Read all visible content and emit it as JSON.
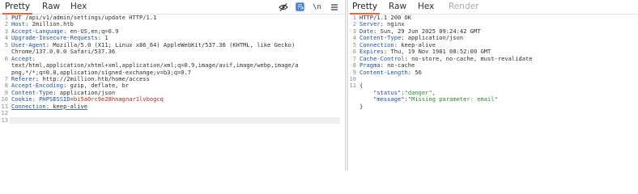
{
  "request": {
    "tabs": [
      "Pretty",
      "Raw",
      "Hex"
    ],
    "toolbar_wrap_icon_text": "\\n",
    "lines": [
      {
        "n": "1",
        "parts": [
          {
            "t": "PUT /api/v1/admin/settings/update HTTP/1.1",
            "c": "plain"
          }
        ]
      },
      {
        "n": "2",
        "parts": [
          {
            "t": "Host",
            "c": "hdr"
          },
          {
            "t": ": 2million.htb",
            "c": "plain"
          }
        ]
      },
      {
        "n": "3",
        "parts": [
          {
            "t": "Accept-Language",
            "c": "hdr"
          },
          {
            "t": ": en-US,en;q=0.9",
            "c": "plain"
          }
        ]
      },
      {
        "n": "4",
        "parts": [
          {
            "t": "Upgrade-Insecure-Requests",
            "c": "hdr"
          },
          {
            "t": ": 1",
            "c": "plain"
          }
        ]
      },
      {
        "n": "5",
        "parts": [
          {
            "t": "User-Agent",
            "c": "hdr"
          },
          {
            "t": ": Mozilla/5.0 (X11; Linux x86_64) AppleWebKit/537.36 (KHTML, like Gecko)",
            "c": "plain"
          }
        ]
      },
      {
        "n": "",
        "parts": [
          {
            "t": "Chrome/137.0.0.0 Safari/537.36",
            "c": "plain"
          }
        ]
      },
      {
        "n": "6",
        "parts": [
          {
            "t": "Accept",
            "c": "hdr"
          },
          {
            "t": ":",
            "c": "plain"
          }
        ]
      },
      {
        "n": "",
        "parts": [
          {
            "t": "text/html,application/xhtml+xml,application/xml;q=0.9,image/avif,image/webp,image/a",
            "c": "plain"
          }
        ]
      },
      {
        "n": "",
        "parts": [
          {
            "t": "png,*/*;q=0.8,application/signed-exchange;v=b3;q=0.7",
            "c": "plain"
          }
        ]
      },
      {
        "n": "7",
        "parts": [
          {
            "t": "Referer",
            "c": "hdr"
          },
          {
            "t": ": http://2million.htb/home/access",
            "c": "plain"
          }
        ]
      },
      {
        "n": "8",
        "parts": [
          {
            "t": "Accept-Encoding",
            "c": "hdr"
          },
          {
            "t": ": gzip, deflate, br",
            "c": "plain"
          }
        ]
      },
      {
        "n": "9",
        "parts": [
          {
            "t": "Content-Type",
            "c": "hdr"
          },
          {
            "t": ": application/json",
            "c": "plain"
          }
        ]
      },
      {
        "n": "10",
        "parts": [
          {
            "t": "Cookie",
            "c": "hdr"
          },
          {
            "t": ": PHPSESSID",
            "c": "hdr"
          },
          {
            "t": "=",
            "c": "plain"
          },
          {
            "t": "bi5a0rc9e28hnagnar1lvbogcq",
            "c": "cookie-val"
          }
        ]
      },
      {
        "n": "11",
        "parts": [
          {
            "t": "Connection",
            "c": "hdr"
          },
          {
            "t": ": keep-alive",
            "c": "plain"
          }
        ],
        "underline": true
      },
      {
        "n": "12",
        "parts": []
      },
      {
        "n": "13",
        "parts": [],
        "current": true
      }
    ]
  },
  "response": {
    "tabs": [
      "Pretty",
      "Raw",
      "Hex",
      "Render"
    ],
    "lines": [
      {
        "n": "1",
        "parts": [
          {
            "t": "HTTP/1.1 200 OK",
            "c": "plain"
          }
        ]
      },
      {
        "n": "2",
        "parts": [
          {
            "t": "Server",
            "c": "hdr"
          },
          {
            "t": ": nginx",
            "c": "plain"
          }
        ]
      },
      {
        "n": "3",
        "parts": [
          {
            "t": "Date",
            "c": "hdr"
          },
          {
            "t": ": Sun, 29 Jun 2025 09:24:42 GMT",
            "c": "plain"
          }
        ]
      },
      {
        "n": "4",
        "parts": [
          {
            "t": "Content-Type",
            "c": "hdr"
          },
          {
            "t": ": application/json",
            "c": "plain"
          }
        ]
      },
      {
        "n": "5",
        "parts": [
          {
            "t": "Connection",
            "c": "hdr"
          },
          {
            "t": ": keep-alive",
            "c": "plain"
          }
        ]
      },
      {
        "n": "6",
        "parts": [
          {
            "t": "Expires",
            "c": "hdr"
          },
          {
            "t": ": Thu, 19 Nov 1981 08:52:00 GMT",
            "c": "plain"
          }
        ]
      },
      {
        "n": "7",
        "parts": [
          {
            "t": "Cache-Control",
            "c": "hdr"
          },
          {
            "t": ": no-store, no-cache, must-revalidate",
            "c": "plain"
          }
        ]
      },
      {
        "n": "8",
        "parts": [
          {
            "t": "Pragma",
            "c": "hdr"
          },
          {
            "t": ": no-cache",
            "c": "plain"
          }
        ]
      },
      {
        "n": "9",
        "parts": [
          {
            "t": "Content-Length",
            "c": "hdr"
          },
          {
            "t": ": 56",
            "c": "plain"
          }
        ]
      },
      {
        "n": "10",
        "parts": []
      },
      {
        "n": "11",
        "parts": [
          {
            "t": "{",
            "c": "plain"
          }
        ]
      },
      {
        "n": "",
        "parts": [
          {
            "t": "    ",
            "c": "plain"
          },
          {
            "t": "\"status\"",
            "c": "key"
          },
          {
            "t": ":",
            "c": "plain"
          },
          {
            "t": "\"danger\"",
            "c": "str"
          },
          {
            "t": ",",
            "c": "plain"
          }
        ]
      },
      {
        "n": "",
        "parts": [
          {
            "t": "    ",
            "c": "plain"
          },
          {
            "t": "\"message\"",
            "c": "key"
          },
          {
            "t": ":",
            "c": "plain"
          },
          {
            "t": "\"Missing parameter: email\"",
            "c": "str"
          }
        ]
      },
      {
        "n": "",
        "parts": [
          {
            "t": "}",
            "c": "plain"
          }
        ]
      }
    ]
  },
  "icons": {
    "eye_slash": "eye-slash-icon",
    "wrap": "wrap-lines-icon",
    "newline": "newline-icon",
    "menu": "hamburger-menu-icon"
  },
  "colors": {
    "active_tab_underline": "#e8663a",
    "header_name": "#1f4fa6",
    "string": "#2c8a2c",
    "cookie_value": "#b1261e"
  }
}
